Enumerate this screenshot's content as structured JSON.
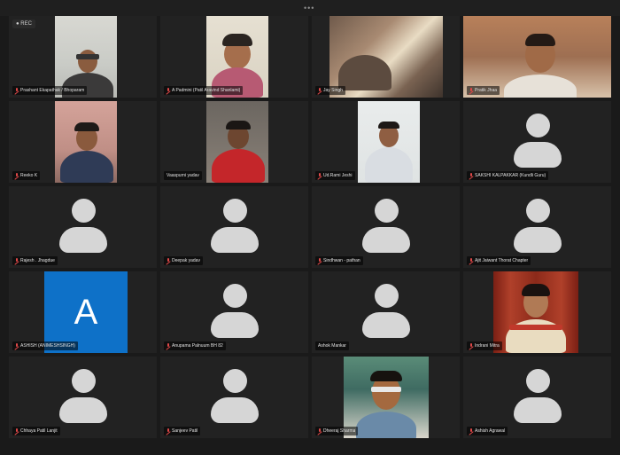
{
  "window": {
    "menu_dots": "•••",
    "recording_badge": "● REC"
  },
  "colors": {
    "tile_bg": "#222222",
    "avatar": "#d6d6d6",
    "muted_mic": "#e04848",
    "initial_tile": "#0e71c8"
  },
  "participants": [
    {
      "name": "Prashant Ekapathak / Bhoparam",
      "muted": true,
      "kind": "video"
    },
    {
      "name": "A Padmini (Patil Aravind Shanlami)",
      "muted": true,
      "kind": "video"
    },
    {
      "name": "Jay Singh",
      "muted": true,
      "kind": "video"
    },
    {
      "name": "Pratik Jhaa",
      "muted": true,
      "kind": "video"
    },
    {
      "name": "Reeko K",
      "muted": true,
      "kind": "video"
    },
    {
      "name": "Vaaspurni yadav",
      "muted": false,
      "kind": "video"
    },
    {
      "name": "Ud.Rami Jeshi",
      "muted": true,
      "kind": "video"
    },
    {
      "name": "SAKSHI KALPAKKAR (Kundli Guru)",
      "muted": true,
      "kind": "avatar"
    },
    {
      "name": "Rajesh . Jhagdue",
      "muted": true,
      "kind": "avatar"
    },
    {
      "name": "Deepak yadav",
      "muted": true,
      "kind": "avatar"
    },
    {
      "name": "Sindhwan - pathan",
      "muted": true,
      "kind": "avatar"
    },
    {
      "name": "Ajit Jaiwant Thorat Chapter",
      "muted": true,
      "kind": "avatar"
    },
    {
      "name": "ASHISH (ANIMESHSINGH)",
      "muted": true,
      "kind": "initial",
      "initial": "A"
    },
    {
      "name": "Anupama Palnuum BH 82",
      "muted": true,
      "kind": "avatar"
    },
    {
      "name": "Ashok Mankar",
      "muted": false,
      "kind": "avatar"
    },
    {
      "name": "Indrani Mitra",
      "muted": true,
      "kind": "video"
    },
    {
      "name": "Chhaya Patil Lanjit",
      "muted": true,
      "kind": "avatar"
    },
    {
      "name": "Sanjeev Patil",
      "muted": true,
      "kind": "avatar"
    },
    {
      "name": "Dheeraj Sharma",
      "muted": true,
      "kind": "video"
    },
    {
      "name": "Ashish Agrawal",
      "muted": true,
      "kind": "avatar"
    }
  ]
}
